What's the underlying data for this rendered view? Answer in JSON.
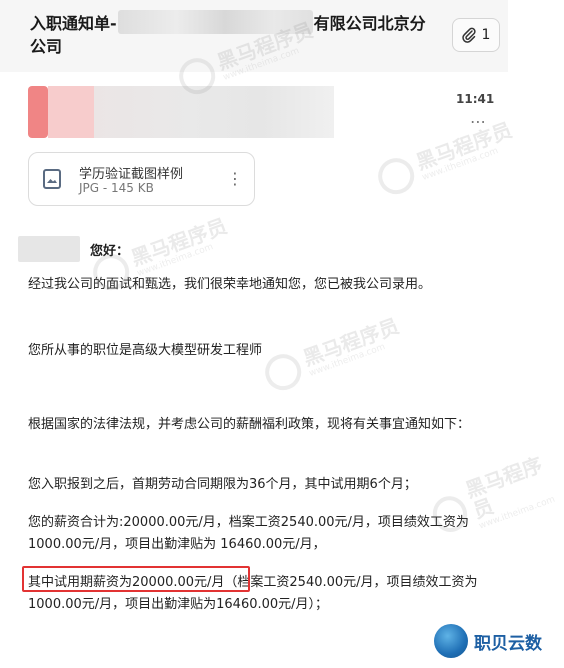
{
  "header": {
    "subject_start": "入职通知单-",
    "subject_end": "有限公司北京分公司",
    "attachment_count": "1"
  },
  "message": {
    "time": "11:41",
    "more_glyph": "⋯"
  },
  "attachment": {
    "name": "学历验证截图样例",
    "meta": "JPG - 145 KB",
    "more_glyph": "⋮"
  },
  "body": {
    "greeting": "您好：",
    "p1": "经过我公司的面试和甄选，我们很荣幸地通知您，您已被我公司录用。",
    "p2": "您所从事的职位是高级大模型研发工程师",
    "p3": "根据国家的法律法规，并考虑公司的薪酬福利政策，现将有关事宜通知如下：",
    "p4": "您入职报到之后，首期劳动合同期限为36个月，其中试用期6个月；",
    "p5": "您的薪资合计为:20000.00元/月，档案工资2540.00元/月，项目绩效工资为1000.00元/月，项目出勤津贴为 16460.00元/月，",
    "p6": "其中试用期薪资为20000.00元/月（档案工资2540.00元/月，项目绩效工资为1000.00元/月，项目出勤津贴为16460.00元/月）；"
  },
  "watermark": {
    "text": "黑马程序员",
    "url": "www.itheima.com"
  },
  "brand": {
    "name": "职贝云数"
  },
  "icons": [
    "paperclip-icon",
    "more-horizontal-icon",
    "image-file-icon",
    "more-vertical-icon",
    "brand-logo-icon"
  ]
}
